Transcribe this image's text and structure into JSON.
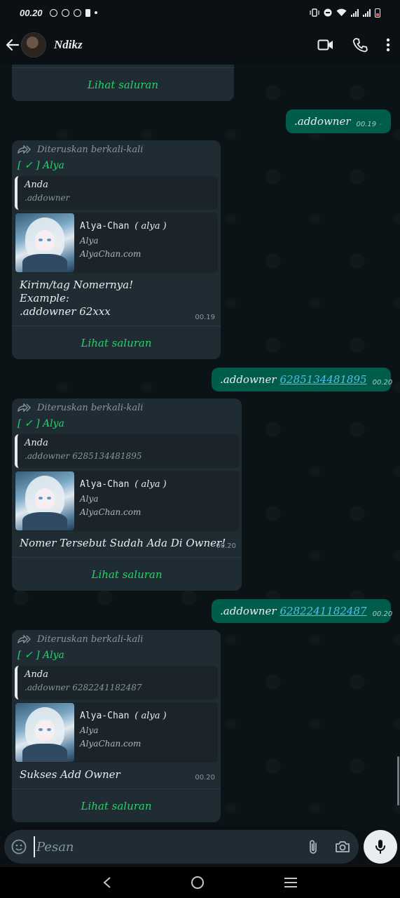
{
  "status_bar": {
    "time": "00.20"
  },
  "header": {
    "contact_name": "Ndikz"
  },
  "top_partial": {
    "channel_label": "Lihat saluran"
  },
  "messages": [
    {
      "type": "outgoing",
      "text": ".addowner",
      "number": "",
      "time": "00.19"
    },
    {
      "type": "incoming",
      "forwarded_label": "Diteruskan berkali-kali",
      "sender": "[ ✓ ] Alya",
      "quote": {
        "author": "Anda",
        "text": ".addowner"
      },
      "preview": {
        "title_prefix": "Alya-Chan",
        "title_suffix": "( alya )",
        "subtitle": "Alya",
        "domain": "AlyaChan.com"
      },
      "body_lines": [
        "Kirim/tag Nomernya!",
        "Example:",
        ".addowner 62xxx"
      ],
      "time": "00.19",
      "channel_label": "Lihat saluran"
    },
    {
      "type": "outgoing",
      "text": ".addowner",
      "number": "6285134481895",
      "time": "00.20"
    },
    {
      "type": "incoming",
      "forwarded_label": "Diteruskan berkali-kali",
      "sender": "[ ✓ ] Alya",
      "quote": {
        "author": "Anda",
        "text": ".addowner 6285134481895"
      },
      "preview": {
        "title_prefix": "Alya-Chan",
        "title_suffix": "( alya )",
        "subtitle": "Alya",
        "domain": "AlyaChan.com"
      },
      "body_lines": [
        "Nomer Tersebut Sudah Ada Di Owner!"
      ],
      "time": "00.20",
      "channel_label": "Lihat saluran"
    },
    {
      "type": "outgoing",
      "text": ".addowner",
      "number": "6282241182487",
      "time": "00.20"
    },
    {
      "type": "incoming",
      "forwarded_label": "Diteruskan berkali-kali",
      "sender": "[ ✓ ] Alya",
      "quote": {
        "author": "Anda",
        "text": ".addowner 6282241182487"
      },
      "preview": {
        "title_prefix": "Alya-Chan",
        "title_suffix": "( alya )",
        "subtitle": "Alya",
        "domain": "AlyaChan.com"
      },
      "body_lines": [
        "Sukses Add Owner"
      ],
      "time": "00.20",
      "channel_label": "Lihat saluran"
    }
  ],
  "input": {
    "placeholder": "Pesan"
  },
  "colors": {
    "outgoing_bubble": "#005c4b",
    "incoming_bubble": "#1f2c33",
    "accent_green": "#25d366",
    "link_blue": "#53bdeb"
  },
  "icons": [
    "back-arrow-icon",
    "video-call-icon",
    "voice-call-icon",
    "more-options-icon",
    "forwarded-icon",
    "read-receipt-icon",
    "sticker-icon",
    "attach-icon",
    "camera-icon",
    "mic-icon",
    "nav-back-icon",
    "nav-home-icon",
    "nav-recents-icon"
  ]
}
